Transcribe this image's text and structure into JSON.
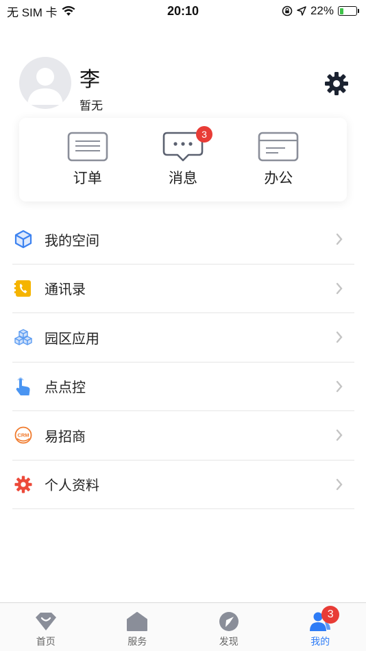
{
  "status": {
    "carrier": "无 SIM 卡",
    "time": "20:10",
    "battery": "22%",
    "battery_level": 0.22
  },
  "profile": {
    "name": "李",
    "subtitle": "暂无"
  },
  "quick": [
    {
      "label": "订单",
      "icon": "order-icon"
    },
    {
      "label": "消息",
      "icon": "message-icon",
      "badge": "3"
    },
    {
      "label": "办公",
      "icon": "office-icon"
    }
  ],
  "menu": [
    {
      "label": "我的空间",
      "icon": "cube-icon"
    },
    {
      "label": "通讯录",
      "icon": "phone-book-icon"
    },
    {
      "label": "园区应用",
      "icon": "park-apps-icon"
    },
    {
      "label": "点点控",
      "icon": "touch-control-icon"
    },
    {
      "label": "易招商",
      "icon": "crm-icon",
      "icon_text": "CRM"
    },
    {
      "label": "个人资料",
      "icon": "gear-icon"
    }
  ],
  "tabs": [
    {
      "label": "首页",
      "icon": "diamond-home-icon"
    },
    {
      "label": "服务",
      "icon": "house-icon"
    },
    {
      "label": "发现",
      "icon": "compass-icon"
    },
    {
      "label": "我的",
      "icon": "user-group-icon",
      "badge": "3",
      "active": true
    }
  ],
  "colors": {
    "accent": "#2e7cf6",
    "badge": "#e83c36",
    "chevron": "#c4c4c4",
    "icon_gray": "#8a8e99"
  }
}
